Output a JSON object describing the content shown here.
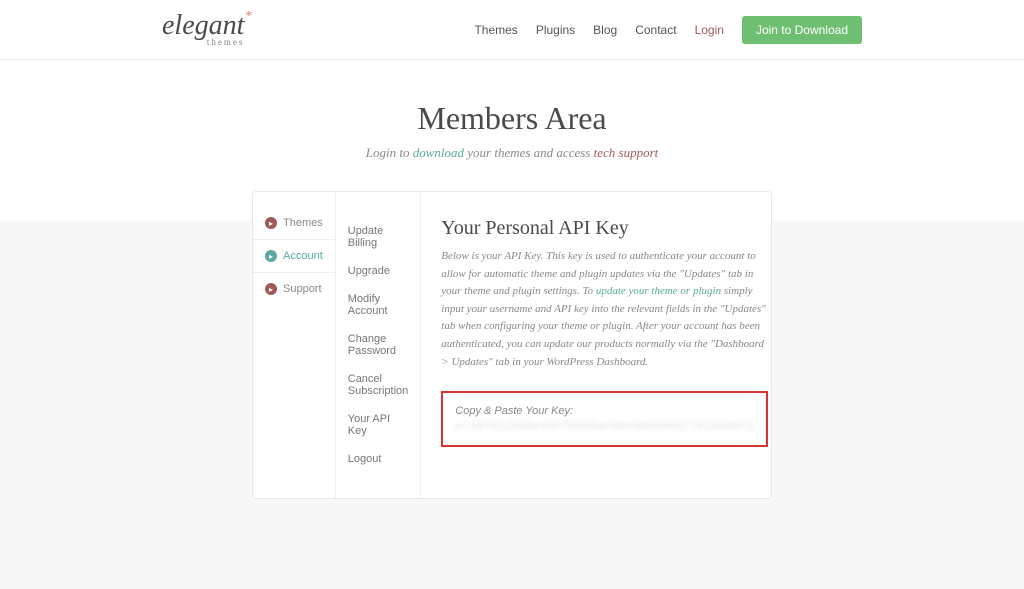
{
  "header": {
    "logo_text": "elegant",
    "logo_subtitle": "themes",
    "nav": {
      "themes": "Themes",
      "plugins": "Plugins",
      "blog": "Blog",
      "contact": "Contact",
      "login": "Login",
      "join": "Join to Download"
    }
  },
  "hero": {
    "title": "Members Area",
    "subtitle_prefix": "Login to ",
    "subtitle_download": "download",
    "subtitle_middle": " your themes and access ",
    "subtitle_tech": "tech support"
  },
  "sidebar": {
    "themes": "Themes",
    "account": "Account",
    "support": "Support"
  },
  "subnav": {
    "update_billing": "Update Billing",
    "upgrade": "Upgrade",
    "modify_account": "Modify Account",
    "change_password": "Change Password",
    "cancel_subscription": "Cancel Subscription",
    "your_api_key": "Your API Key",
    "logout": "Logout"
  },
  "content": {
    "heading": "Your Personal API Key",
    "desc_1": "Below is your API Key. This key is used to authenticate your account to allow for automatic theme and plugin updates via the \"Updates\" tab in your theme and plugin settings. To ",
    "desc_link": "update your theme or plugin",
    "desc_2": " simply input your username and API key into the relevant fields in the \"Updates\" tab when configuring your theme or plugin. After your account has been authenticated, you can update our products normally via the \"Dashboard > Updates\" tab in your WordPress Dashboard.",
    "key_label": "Copy & Paste Your Key:",
    "key_value": "e7187e12b58e437fb846acb0c9b099047761db4e72"
  }
}
